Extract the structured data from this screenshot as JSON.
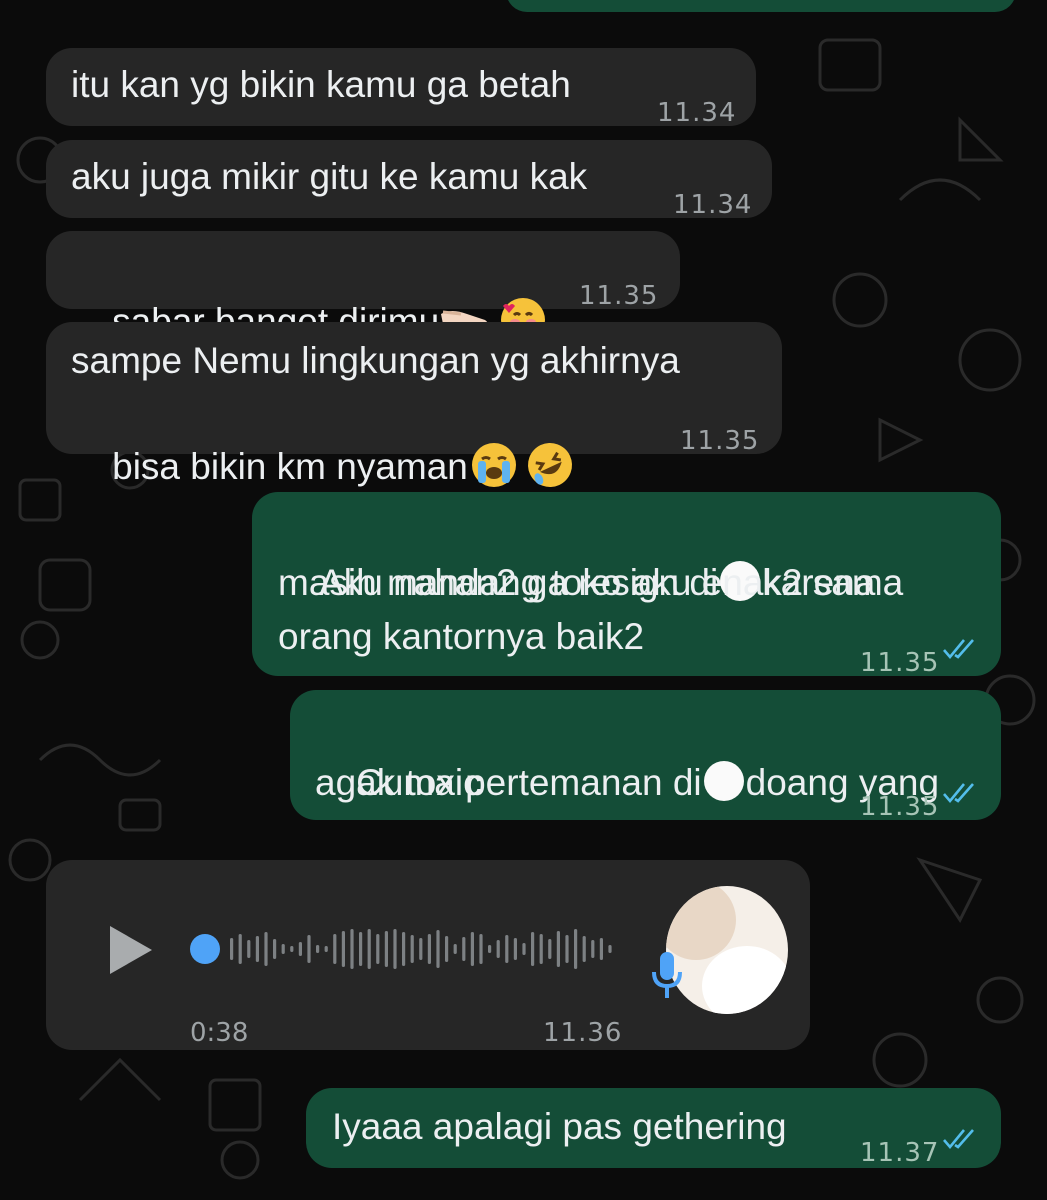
{
  "messages": [
    {
      "id": "m0",
      "side": "out",
      "text": "",
      "time": ""
    },
    {
      "id": "m1",
      "side": "in",
      "text": "itu kan yg bikin kamu ga betah",
      "time": "11.34"
    },
    {
      "id": "m2",
      "side": "in",
      "text": "aku juga mikir gitu ke kamu kak",
      "time": "11.34"
    },
    {
      "id": "m3",
      "side": "in",
      "text": "sabar banget dirimu",
      "emojis": [
        "pinching-hand",
        "smiling-face-with-hearts"
      ],
      "time": "11.35"
    },
    {
      "id": "m4",
      "side": "in",
      "line1": "sampe Nemu lingkungan yg akhirnya",
      "line2": "bisa bikin km nyaman",
      "emojis": [
        "loudly-crying-face",
        "rolling-on-floor-laughing"
      ],
      "time": "11.35"
    },
    {
      "id": "m5",
      "side": "out",
      "line1a": "Aku nahan2 ga resign di",
      "line1b": "karena",
      "line2": "masih mandang toko aku enak2 sama",
      "line3": "orang kantornya baik2",
      "time": "11.35",
      "status": "read"
    },
    {
      "id": "m6",
      "side": "out",
      "line1a": "Cuma pertemanan di",
      "line1b": "doang yang",
      "line2": "agak toxic",
      "time": "11.35",
      "status": "read"
    },
    {
      "id": "m7",
      "side": "in",
      "type": "voice-note",
      "duration": "0:38",
      "time": "11.36"
    },
    {
      "id": "m8",
      "side": "out",
      "text": "Iyaaa apalagi pas gethering",
      "time": "11.37",
      "status": "read"
    }
  ],
  "colors": {
    "incoming": "#262626",
    "outgoing": "#144d37",
    "read_ticks": "#53bdeb",
    "voice_dot": "#4fa3f7",
    "mic": "#4fa3f7"
  }
}
